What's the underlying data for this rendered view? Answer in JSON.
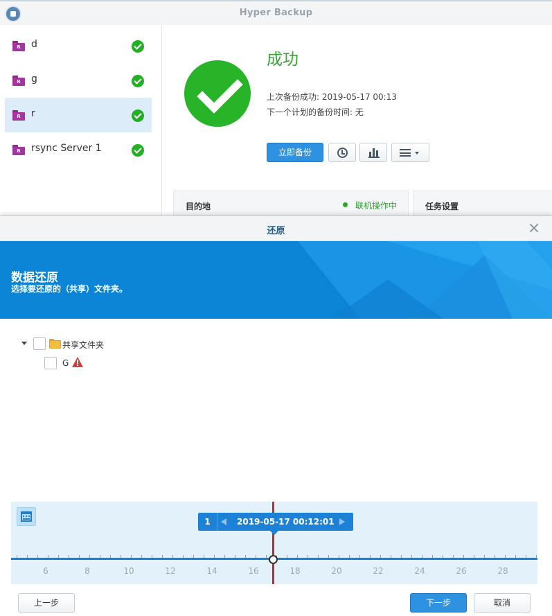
{
  "app": {
    "title": "Hyper Backup"
  },
  "tasks": [
    {
      "name": "d",
      "badge": "R",
      "status": "success"
    },
    {
      "name": "g",
      "badge": "R",
      "status": "success"
    },
    {
      "name": "r",
      "badge": "R",
      "status": "success",
      "selected": true
    },
    {
      "name": "rsync Server 1",
      "badge": "R",
      "status": "success"
    }
  ],
  "status": {
    "title": "成功",
    "last_backup": "上次备份成功: 2019-05-17 00:13",
    "next_backup": "下一个计划的备份时间: 无"
  },
  "toolbar": {
    "backup_now": "立即备份",
    "history_icon": "clock-icon",
    "stats_icon": "bar-chart-icon",
    "menu_icon": "menu-icon"
  },
  "panels": {
    "destination": "目的地",
    "online_status": "联机操作中",
    "task_settings": "任务设置"
  },
  "dialog": {
    "title": "还原",
    "banner_title": "数据还原",
    "banner_subtitle": "选择要还原的（共享）文件夹。",
    "tree": {
      "root": {
        "label": "共享文件夹",
        "expanded": true,
        "checked": false
      },
      "children": [
        {
          "label": "G",
          "checked": false,
          "warning": true
        }
      ]
    },
    "timeline": {
      "version_count": "1",
      "selected_version": "2019-05-17 00:12:01",
      "tick_labels": [
        "6",
        "8",
        "10",
        "12",
        "14",
        "16",
        "18",
        "20",
        "22",
        "24",
        "26",
        "28"
      ]
    },
    "buttons": {
      "previous": "上一步",
      "next": "下一步",
      "cancel": "取消"
    }
  },
  "colors": {
    "success_green": "#28b428",
    "primary_blue": "#2e92e0",
    "banner_blue": "#0b84d6",
    "marker_red": "#c8272e",
    "task_badge_purple": "#a4349f"
  }
}
